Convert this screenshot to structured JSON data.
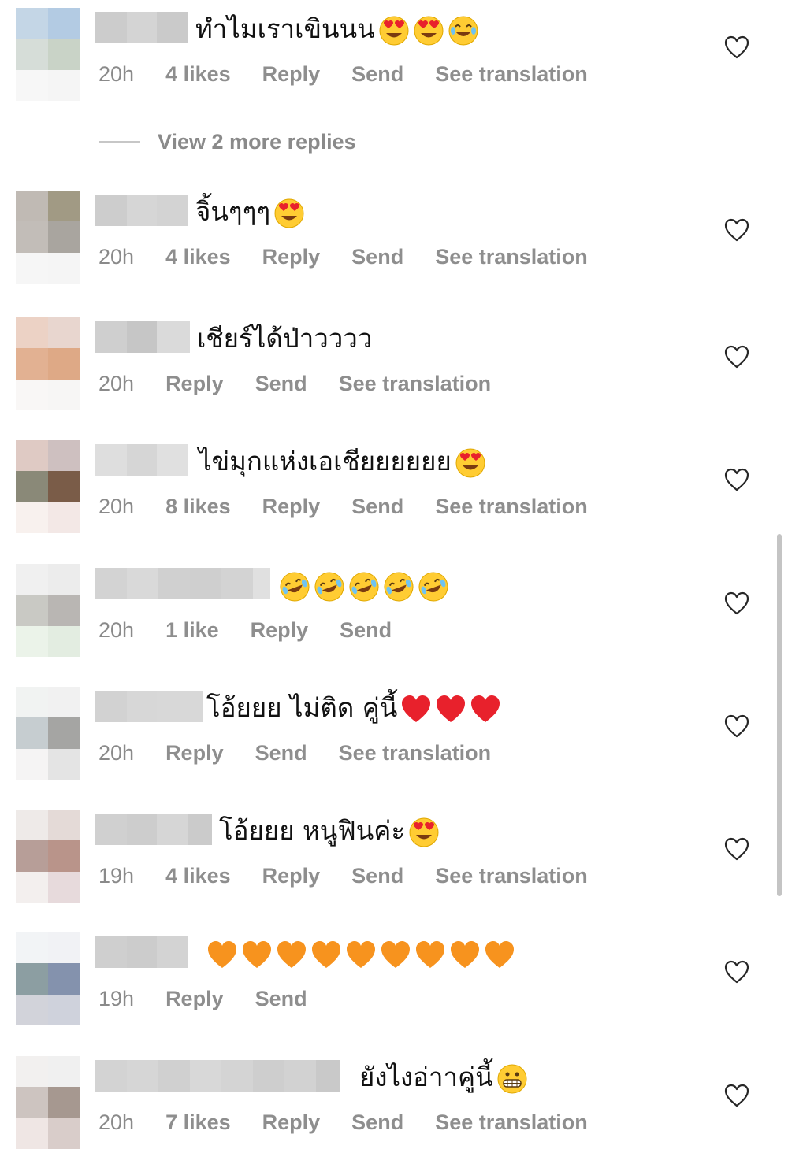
{
  "view_more_replies": "View 2 more replies",
  "comments": [
    {
      "text": "ทำไมเราเขินนน",
      "emojis": [
        "heart-eyes",
        "heart-eyes",
        "tears-of-joy"
      ],
      "time": "20h",
      "likes": "4 likes",
      "reply": "Reply",
      "send": "Send",
      "translation": "See translation"
    },
    {
      "text": "จิ้นๆๆๆ",
      "emojis": [
        "heart-eyes"
      ],
      "time": "20h",
      "likes": "4 likes",
      "reply": "Reply",
      "send": "Send",
      "translation": "See translation"
    },
    {
      "text": "เชียร์ได้ป่าวววว",
      "emojis": [],
      "time": "20h",
      "likes": "",
      "reply": "Reply",
      "send": "Send",
      "translation": "See translation"
    },
    {
      "text": "ไข่มุกแห่งเอเชียยยยยย",
      "emojis": [
        "heart-eyes"
      ],
      "time": "20h",
      "likes": "8 likes",
      "reply": "Reply",
      "send": "Send",
      "translation": "See translation"
    },
    {
      "text": "",
      "emojis": [
        "rofl",
        "rofl",
        "rofl",
        "rofl",
        "rofl"
      ],
      "time": "20h",
      "likes": "1 like",
      "reply": "Reply",
      "send": "Send",
      "translation": ""
    },
    {
      "text": "โอ้ยยย ไม่ติด คู่นี้",
      "emojis": [
        "red-heart",
        "red-heart",
        "red-heart"
      ],
      "time": "20h",
      "likes": "",
      "reply": "Reply",
      "send": "Send",
      "translation": "See translation"
    },
    {
      "text": "โอ้ยยย หนูฟินค่ะ",
      "emojis": [
        "heart-eyes"
      ],
      "time": "19h",
      "likes": "4 likes",
      "reply": "Reply",
      "send": "Send",
      "translation": "See translation"
    },
    {
      "text": "",
      "emojis": [
        "orange-heart",
        "orange-heart",
        "orange-heart",
        "orange-heart",
        "orange-heart",
        "orange-heart",
        "orange-heart",
        "orange-heart",
        "orange-heart"
      ],
      "time": "19h",
      "likes": "",
      "reply": "Reply",
      "send": "Send",
      "translation": ""
    },
    {
      "text": "ยังไงอ่าาคู่นี้",
      "emojis": [
        "grimacing"
      ],
      "time": "20h",
      "likes": "7 likes",
      "reply": "Reply",
      "send": "Send",
      "translation": "See translation"
    }
  ],
  "colors": {
    "meta_text": "#8a8a8a",
    "comment_text": "#111111",
    "heart_outline": "#262626",
    "red_heart": "#e8212c",
    "orange_heart": "#f7931e",
    "emoji_face": "#ffcc33"
  }
}
